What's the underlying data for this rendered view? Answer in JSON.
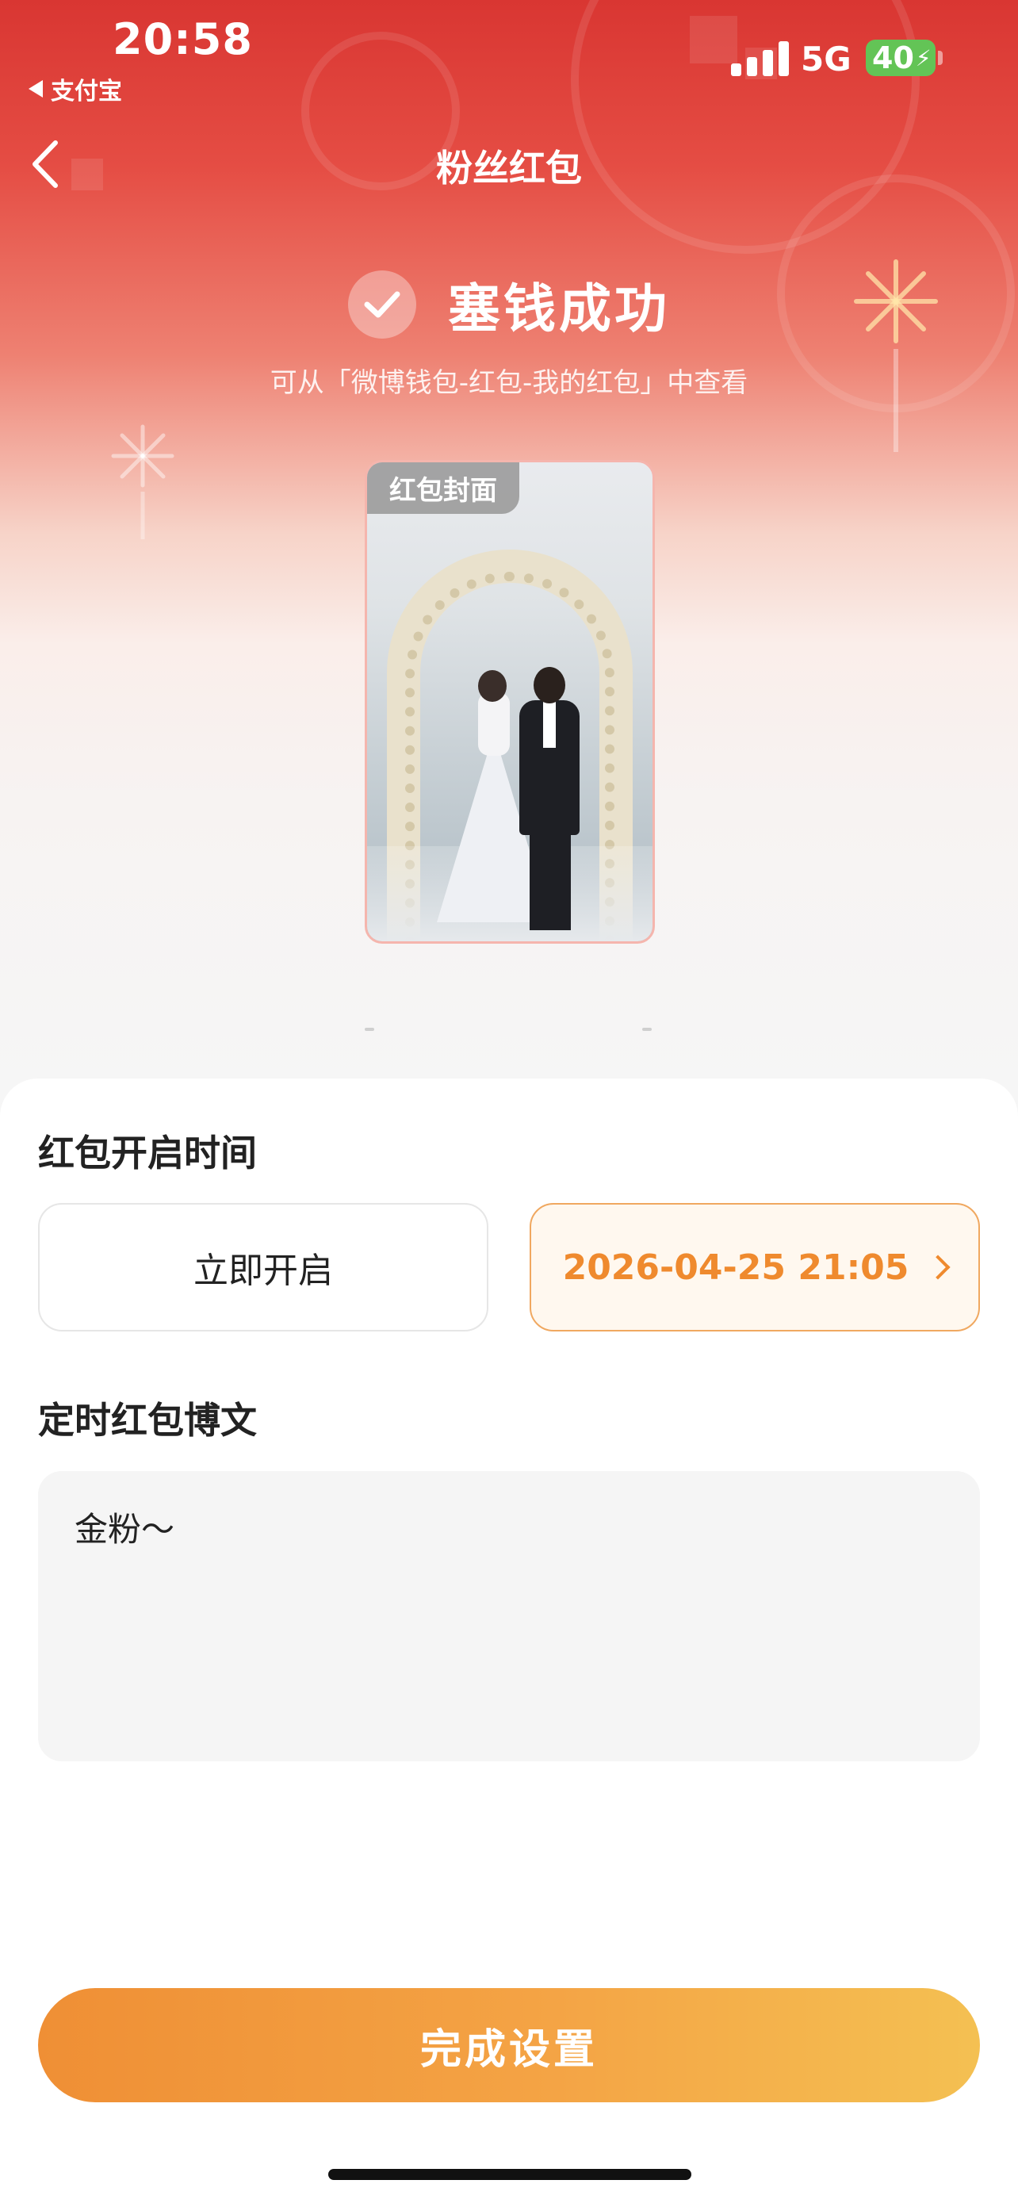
{
  "status_bar": {
    "time": "20:58",
    "back_app": "支付宝",
    "network": "5G",
    "battery": "40"
  },
  "nav": {
    "title": "粉丝红包"
  },
  "success": {
    "title": "塞钱成功",
    "subtitle": "可从「微博钱包-红包-我的红包」中查看"
  },
  "cover": {
    "label": "红包封面"
  },
  "open_time": {
    "section_title": "红包开启时间",
    "options": [
      {
        "label": "立即开启",
        "selected": false
      },
      {
        "label": "2026-04-25 21:05",
        "selected": true
      }
    ]
  },
  "post": {
    "section_title": "定时红包博文",
    "content": "金粉～"
  },
  "footer": {
    "finish_label": "完成设置"
  },
  "colors": {
    "header_red": "#d93632",
    "accent_orange": "#ef8a2e",
    "button_gradient_start": "#ef8f35",
    "button_gradient_end": "#f4c052"
  }
}
